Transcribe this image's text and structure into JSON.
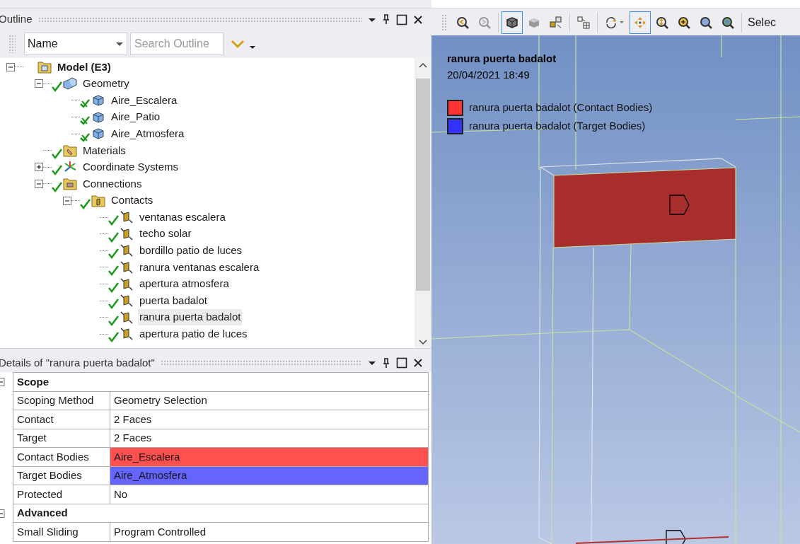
{
  "outline": {
    "title": "Outline",
    "filter": {
      "value": "Name"
    },
    "search": {
      "placeholder": "Search Outline"
    },
    "tree": [
      {
        "label": "Model (E3)",
        "kind": "model",
        "expanded": true,
        "selected": false,
        "children": [
          {
            "label": "Geometry",
            "kind": "geometry",
            "expanded": true,
            "selected": false,
            "children": [
              {
                "label": "Aire_Escalera",
                "kind": "body",
                "selected": false
              },
              {
                "label": "Aire_Patio",
                "kind": "body",
                "selected": false
              },
              {
                "label": "Aire_Atmosfera",
                "kind": "body",
                "selected": false
              }
            ]
          },
          {
            "label": "Materials",
            "kind": "materials",
            "selected": false
          },
          {
            "label": "Coordinate Systems",
            "kind": "coordinates",
            "expanded": false,
            "selected": false
          },
          {
            "label": "Connections",
            "kind": "connections",
            "expanded": true,
            "selected": false,
            "children": [
              {
                "label": "Contacts",
                "kind": "contacts",
                "expanded": true,
                "selected": false,
                "children": [
                  {
                    "label": "ventanas escalera",
                    "kind": "contact",
                    "selected": false
                  },
                  {
                    "label": "techo solar",
                    "kind": "contact",
                    "selected": false
                  },
                  {
                    "label": "bordillo patio de luces",
                    "kind": "contact",
                    "selected": false
                  },
                  {
                    "label": "ranura ventanas escalera",
                    "kind": "contact",
                    "selected": false
                  },
                  {
                    "label": "apertura atmosfera",
                    "kind": "contact",
                    "selected": false
                  },
                  {
                    "label": "puerta badalot",
                    "kind": "contact",
                    "selected": false
                  },
                  {
                    "label": "ranura puerta badalot",
                    "kind": "contact",
                    "selected": true
                  },
                  {
                    "label": "apertura patio de luces",
                    "kind": "contact",
                    "selected": false
                  }
                ]
              }
            ]
          }
        ]
      }
    ]
  },
  "details": {
    "title": "Details of \"ranura puerta badalot\"",
    "rows": [
      {
        "kind": "section",
        "label": "Scope",
        "expanded": true
      },
      {
        "kind": "property",
        "label": "Scoping Method",
        "value": "Geometry Selection"
      },
      {
        "kind": "property",
        "label": "Contact",
        "value": "2 Faces"
      },
      {
        "kind": "property",
        "label": "Target",
        "value": "2 Faces"
      },
      {
        "kind": "property",
        "label": "Contact Bodies",
        "value": "Aire_Escalera",
        "color": "#ff5050"
      },
      {
        "kind": "property",
        "label": "Target Bodies",
        "value": "Aire_Atmosfera",
        "color": "#6464ff"
      },
      {
        "kind": "property",
        "label": "Protected",
        "value": "No"
      },
      {
        "kind": "section",
        "label": "Advanced",
        "expanded": true
      },
      {
        "kind": "property",
        "label": "Small Sliding",
        "value": "Program Controlled"
      }
    ]
  },
  "toolbar": [
    {
      "kind": "zoom-back",
      "selected": false
    },
    {
      "kind": "zoom-forward",
      "selected": false
    },
    {
      "kind": "sep"
    },
    {
      "kind": "solid",
      "selected": true
    },
    {
      "kind": "shaded",
      "selected": false
    },
    {
      "kind": "explode",
      "selected": false
    },
    {
      "kind": "sep"
    },
    {
      "kind": "layout",
      "selected": false
    },
    {
      "kind": "sep"
    },
    {
      "kind": "rotate",
      "selected": false
    },
    {
      "kind": "pan",
      "selected": true
    },
    {
      "kind": "zoom",
      "selected": false
    },
    {
      "kind": "zoom-in",
      "selected": false
    },
    {
      "kind": "zoom-box",
      "selected": false
    },
    {
      "kind": "zoom-fit",
      "selected": false
    },
    {
      "kind": "sep"
    },
    {
      "kind": "text",
      "label": "Selec"
    }
  ],
  "viewport": {
    "title": "ranura puerta badalot",
    "timestamp": "20/04/2021 18:49",
    "legend": [
      {
        "label": "ranura puerta badalot (Contact Bodies)",
        "color": "#ff3333"
      },
      {
        "label": "ranura puerta badalot (Target Bodies)",
        "color": "#3333ff"
      }
    ]
  }
}
